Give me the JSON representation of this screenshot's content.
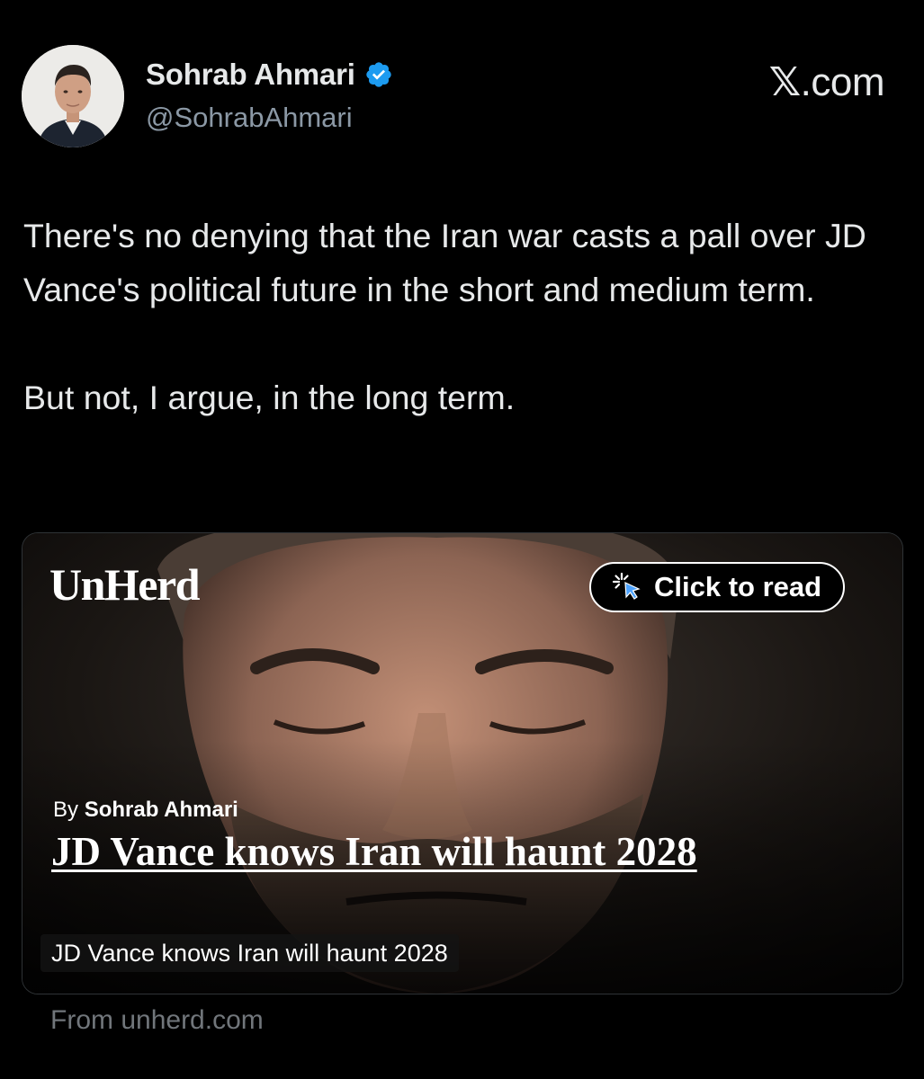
{
  "author": {
    "display_name": "Sohrab Ahmari",
    "handle": "@SohrabAhmari",
    "verified_icon": "verified-badge-icon",
    "avatar_icon": "profile-photo"
  },
  "platform": {
    "logo_x": "𝕏",
    "logo_domain": ".com"
  },
  "tweet": {
    "text": "There's no denying that the Iran war casts a pall over JD Vance's political future in the short and medium term.\n\nBut not, I argue, in the long term."
  },
  "card": {
    "publisher": "UnHerd",
    "cta_label": "Click to read",
    "cta_icon": "cursor-click-icon",
    "byline_prefix": "By",
    "byline_author": "Sohrab Ahmari",
    "headline": "JD Vance knows Iran will haunt 2028",
    "caption": "JD Vance knows Iran will haunt 2028"
  },
  "source": "From unherd.com",
  "colors": {
    "background": "#000000",
    "accent_verified": "#1d9bf0",
    "secondary_text": "#71767b"
  }
}
